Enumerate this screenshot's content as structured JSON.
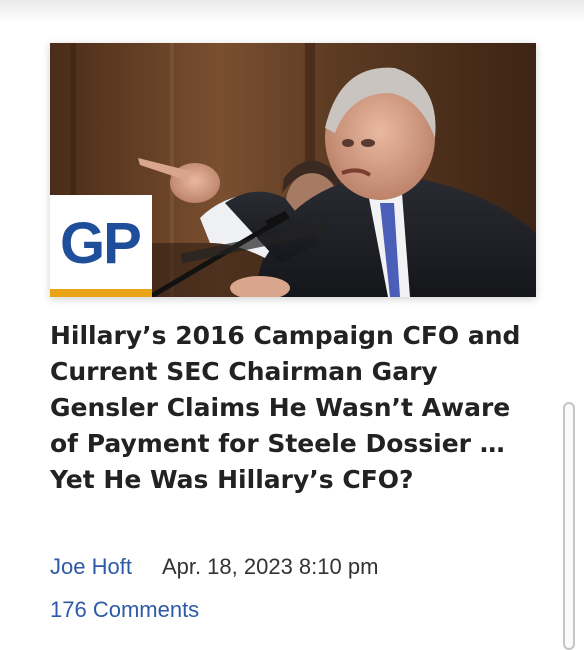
{
  "article": {
    "image": {
      "alt": "SEC Chairman Gary Gensler pointing while testifying",
      "logo_text": "GP"
    },
    "headline": "Hillary’s 2016 Campaign CFO and Current SEC Chairman Gary Gensler Claims He Wasn’t Aware of Payment for Steele Dossier …Yet He Was Hillary’s CFO?",
    "author": "Joe Hoft",
    "date": "Apr. 18, 2023 8:10 pm",
    "comments": "176 Comments"
  },
  "colors": {
    "link": "#2e5aa8",
    "headline": "#222222",
    "logo_blue": "#1f4e9b",
    "logo_gold": "#e8a317"
  }
}
